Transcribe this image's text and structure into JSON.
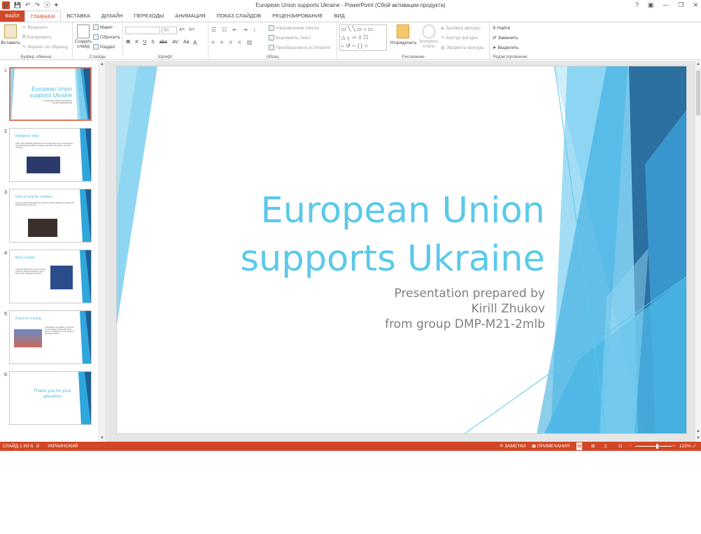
{
  "window": {
    "title": "European Union supports Ukraine - PowerPoint (Сбой активации продукта)",
    "controls": [
      "?",
      "▣",
      "—",
      "❐",
      "✕"
    ]
  },
  "qat": {
    "logo": "P",
    "save": "💾",
    "undo": "↶",
    "redo": "↷",
    "start": "ⓥ",
    "more": "▾"
  },
  "tabs": [
    "ФАЙЛ",
    "ГЛАВНАЯ",
    "ВСТАВКА",
    "ДИЗАЙН",
    "ПЕРЕХОДЫ",
    "АНИМАЦИЯ",
    "ПОКАЗ СЛАЙДОВ",
    "РЕЦЕНЗИРОВАНИЕ",
    "ВИД"
  ],
  "ribbon": {
    "clipboard": {
      "label": "Буфер обмена",
      "paste": "Вставить",
      "cut": "Вырезать",
      "copy": "Копировать",
      "format": "Формат по образцу"
    },
    "slides": {
      "label": "Слайды",
      "new": "Создать",
      "new2": "слайд",
      "layout": "Макет",
      "reset": "Сбросить",
      "section": "Раздел"
    },
    "font": {
      "label": "Шрифт",
      "size": "60",
      "bold": "Ж",
      "italic": "К",
      "underline": "Ч",
      "strike": "S",
      "abc": "abc",
      "av": "AV",
      "aa": "Aa",
      "a": "A"
    },
    "paragraph": {
      "label": "Абзац",
      "dir": "Направление текста",
      "align": "Выровнять текст",
      "smartart": "Преобразовать в SmartArt"
    },
    "drawing": {
      "label": "Рисование",
      "arrange": "Упорядочить",
      "styles": "Экспресс-",
      "styles2": "стили",
      "fill": "Заливка фигуры",
      "outline": "Контур фигуры",
      "effects": "Эффекты фигуры"
    },
    "editing": {
      "label": "Редактирование",
      "find": "Найти",
      "replace": "Заменить",
      "select": "Выделить"
    }
  },
  "thumbs": [
    {
      "num": "1",
      "title": "European Union supports Ukraine",
      "sub": "Presentation prepared by Kirill Zhukov from group DMP-M21-2mlb"
    },
    {
      "num": "2",
      "title": "Refugees' help",
      "text": "Today, many Ukrainian people are forced to leave their homes. The European Union has accepted millions of refugees and offers them shelter, work and education."
    },
    {
      "num": "3",
      "title": "Kind of help for civilians",
      "text": "Europe provides humanitarian aid, medicine, food and housing for civilians who suffered because of the war."
    },
    {
      "num": "4",
      "title": "Best country",
      "text": "A question about which country is best to choose for refugees depends on many things: work, language and support."
    },
    {
      "num": "5",
      "title": "Place for a living",
      "text": "Unfortunately, the situation is such that the percentage of people who return home is increasing, but many still live in European countries."
    },
    {
      "num": "6",
      "title": "Thank you for your attention!"
    }
  ],
  "slide": {
    "title_line1": "European Union",
    "title_line2": "supports Ukraine",
    "sub_line1": "Presentation prepared by",
    "sub_line2": "Kirill Zhukov",
    "sub_line3": "from group DMP-M21-2mlb"
  },
  "status": {
    "slide": "СЛАЙД 1 ИЗ 6",
    "lang": "УКРАИНСКИЙ",
    "notes": "ЗАМЕТКИ",
    "comments": "ПРИМЕЧАНИЯ",
    "zoom": "122%",
    "zoom_level": 0.59
  },
  "colors": {
    "accent": "#d24726",
    "slide_title": "#5bc9ea",
    "blue_dark": "#1f5f94",
    "blue_mid": "#3fa7df",
    "blue_light": "#8fd6f2"
  }
}
